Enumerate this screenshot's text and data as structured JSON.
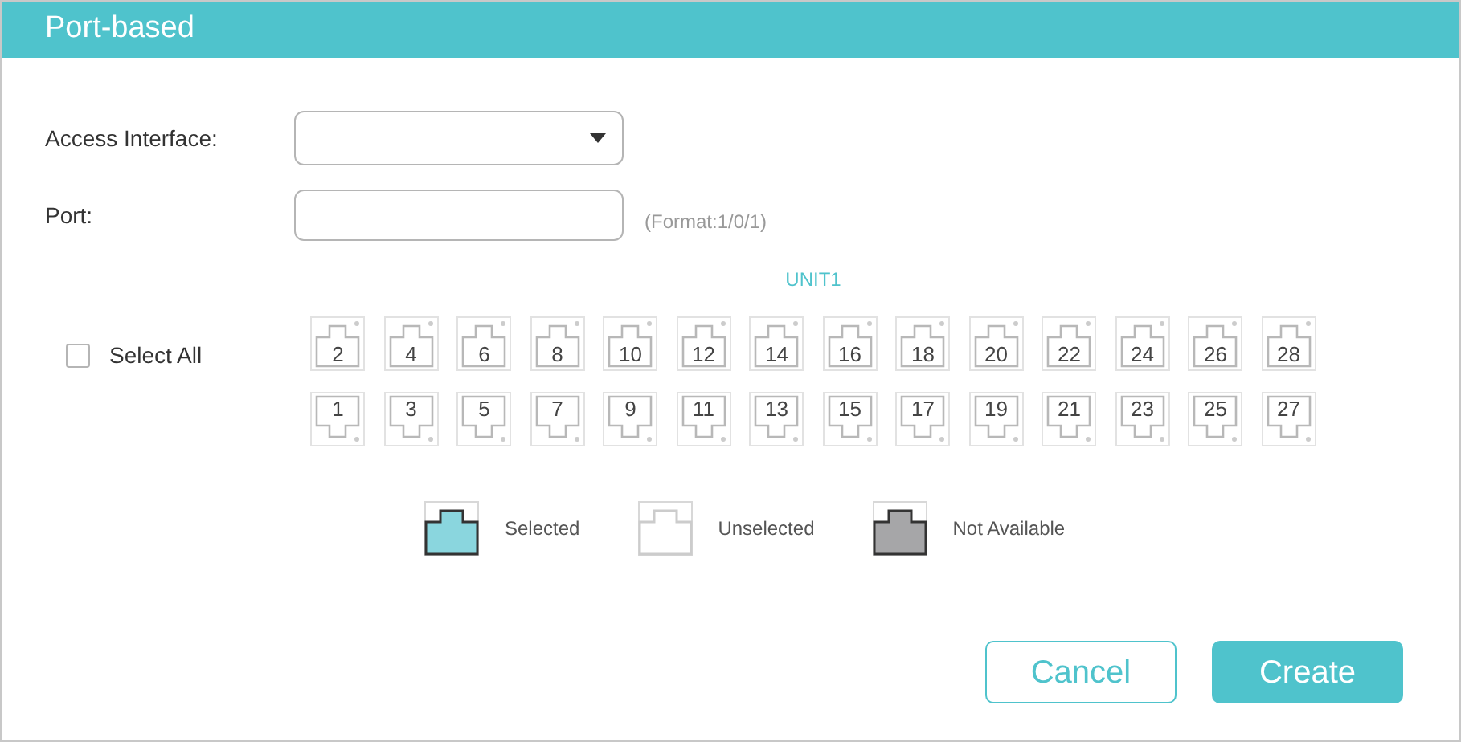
{
  "title": "Port-based",
  "access_interface": {
    "label": "Access Interface:"
  },
  "port": {
    "label": "Port:",
    "hint": "(Format:1/0/1)"
  },
  "unit": "UNIT1",
  "select_all": {
    "label": "Select All",
    "checked": false
  },
  "port_rows": [
    [
      {
        "label": "2",
        "selected": false
      },
      {
        "label": "4",
        "selected": false
      },
      {
        "label": "6",
        "selected": false
      },
      {
        "label": "8",
        "selected": false
      },
      {
        "label": "10",
        "selected": false
      },
      {
        "label": "12",
        "selected": false
      },
      {
        "label": "14",
        "selected": false
      },
      {
        "label": "16",
        "selected": false
      },
      {
        "label": "18",
        "selected": false
      },
      {
        "label": "20",
        "selected": false
      },
      {
        "label": "22",
        "selected": false
      },
      {
        "label": "24",
        "selected": false
      },
      {
        "label": "26",
        "selected": false
      },
      {
        "label": "28",
        "selected": false
      }
    ],
    [
      {
        "label": "1",
        "selected": false
      },
      {
        "label": "3",
        "selected": false
      },
      {
        "label": "5",
        "selected": false
      },
      {
        "label": "7",
        "selected": false
      },
      {
        "label": "9",
        "selected": false
      },
      {
        "label": "11",
        "selected": false
      },
      {
        "label": "13",
        "selected": false
      },
      {
        "label": "15",
        "selected": false
      },
      {
        "label": "17",
        "selected": false
      },
      {
        "label": "19",
        "selected": false
      },
      {
        "label": "21",
        "selected": false
      },
      {
        "label": "23",
        "selected": false
      },
      {
        "label": "25",
        "selected": false
      },
      {
        "label": "27",
        "selected": false
      }
    ]
  ],
  "legend": [
    {
      "kind": "selected",
      "label": "Selected"
    },
    {
      "kind": "unselected",
      "label": "Unselected"
    },
    {
      "kind": "unavailable",
      "label": "Not Available"
    }
  ],
  "buttons": [
    {
      "kind": "secondary",
      "label": "Cancel"
    },
    {
      "kind": "primary",
      "label": "Create"
    }
  ]
}
